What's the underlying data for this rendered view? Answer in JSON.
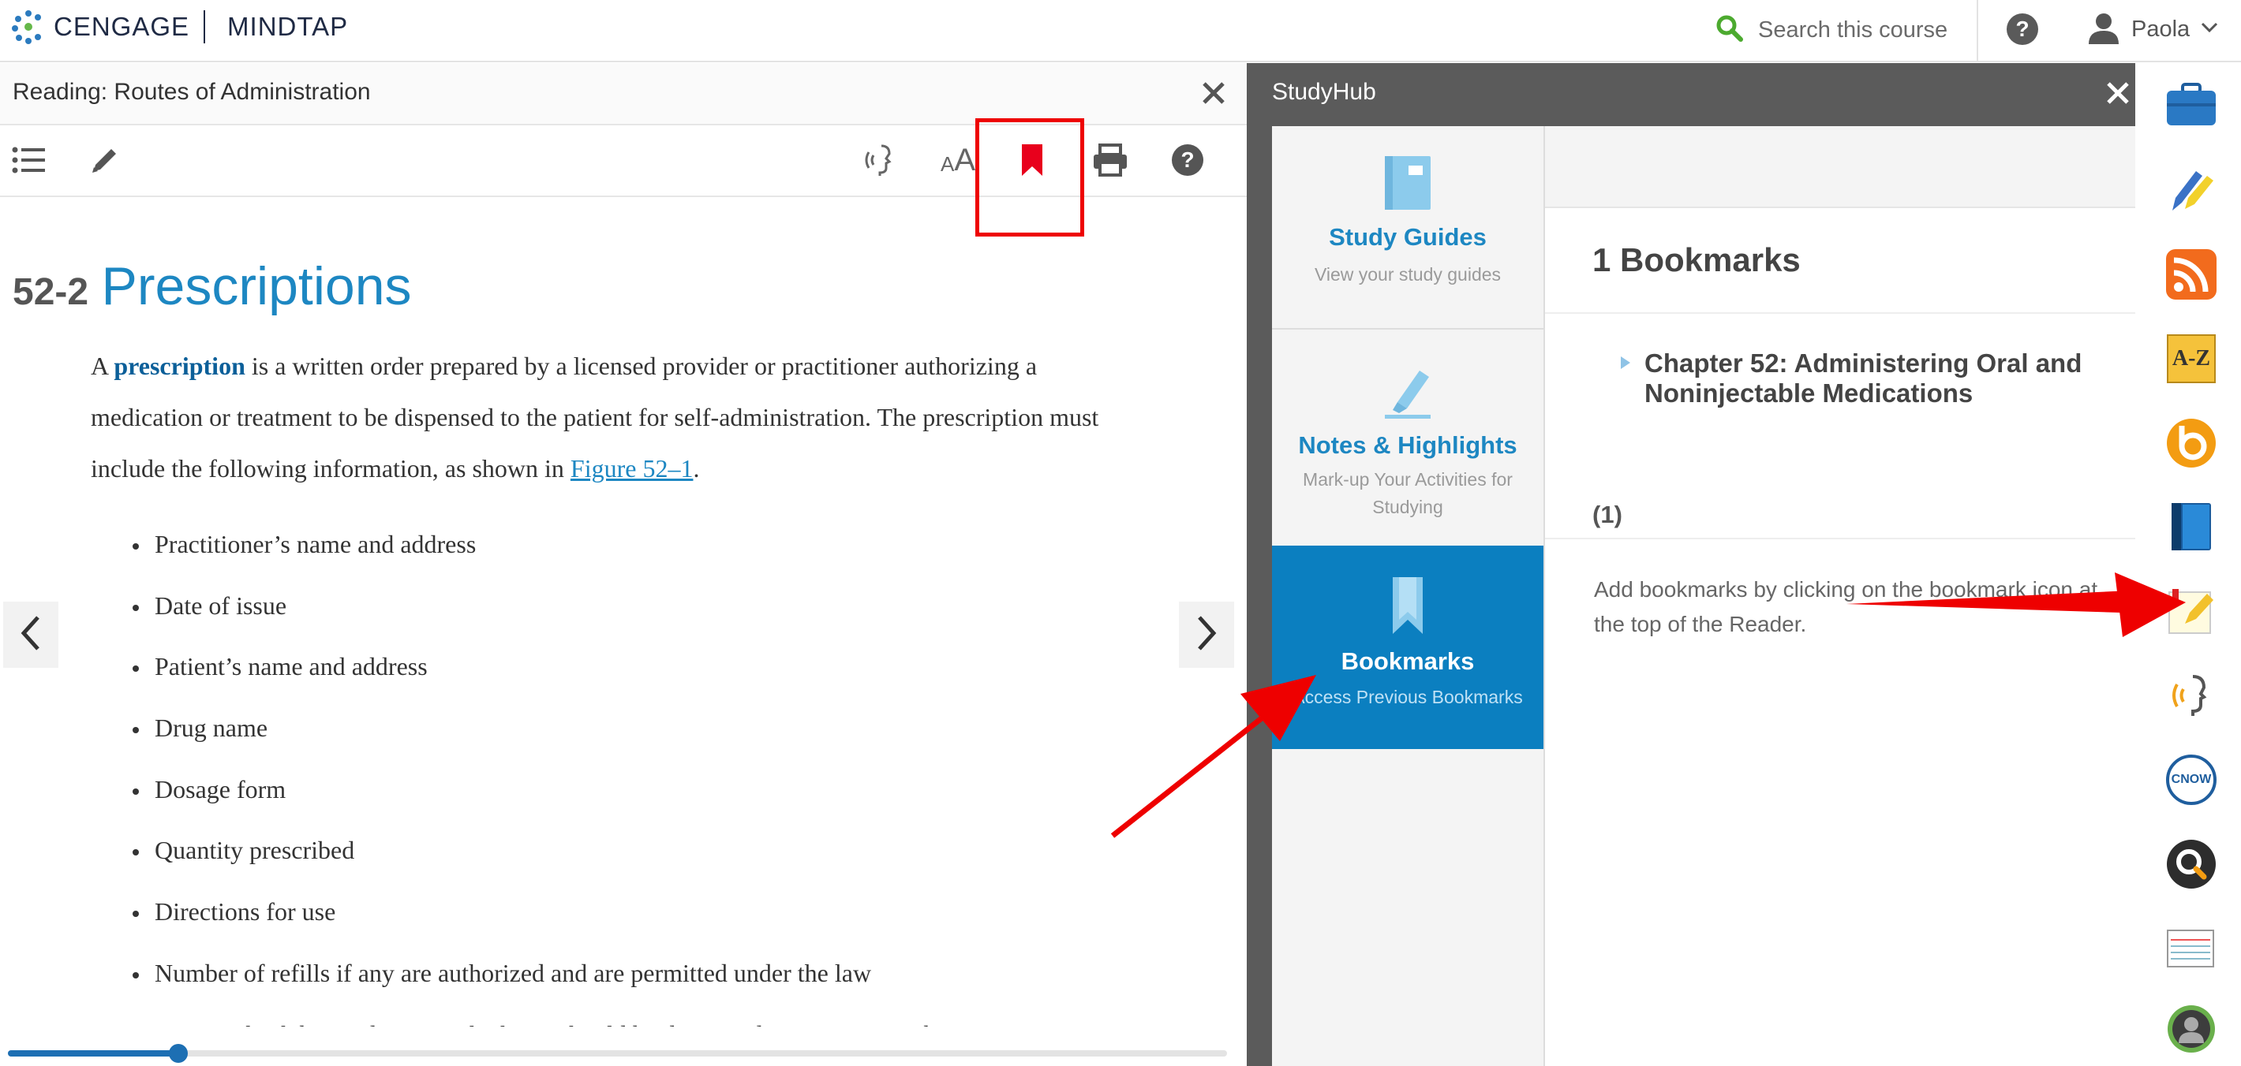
{
  "header": {
    "brand_left": "CENGAGE",
    "brand_right": "MINDTAP",
    "search_label": "Search this course",
    "help_label": "?",
    "user_name": "Paola"
  },
  "reader": {
    "title": "Reading: Routes of Administration",
    "toolbar_icons": [
      "list-icon",
      "pencil-icon",
      "read-aloud-icon",
      "text-size-icon",
      "bookmark-icon",
      "print-icon",
      "help-icon"
    ],
    "text_size_small": "A",
    "text_size_large": "A",
    "section_number": "52-2",
    "section_title": "Prescriptions",
    "para_pre": "A ",
    "para_term": "prescription",
    "para_mid": " is a written order prepared by a licensed provider or practitioner authorizing a medication or treatment to be dispensed to the patient for self-administration. The prescription must include the following information, as shown in ",
    "para_link": "Figure 52–1",
    "para_post": ".",
    "bullets": [
      "Practitioner’s name and address",
      "Date of issue",
      "Patient’s name and address",
      "Drug name",
      "Dosage form",
      "Quantity prescribed",
      "Directions for use",
      "Number of refills if any are authorized and are permitted under the law",
      "Line or check box indicating whether it should be dispensed as written or substitutions"
    ],
    "progress_fraction": 0.14,
    "accent_color": "#1d87c2",
    "bookmark_color": "#e8001c"
  },
  "studyhub": {
    "title": "StudyHub",
    "tabs": [
      {
        "label": "Study Guides",
        "sub": "View your study guides",
        "icon": "study-guide-icon"
      },
      {
        "label": "Notes & Highlights",
        "sub": "Mark-up Your Activities for Studying",
        "icon": "highlighter-icon"
      },
      {
        "label": "Bookmarks",
        "sub": "Access Previous Bookmarks",
        "icon": "bookmark-ribbon-icon"
      }
    ],
    "active_tab": 2,
    "bookmarks_heading": "1 Bookmarks",
    "chapter": "Chapter 52: Administering Oral and Noninjectable Medications",
    "count": "(1)",
    "hint": "Add bookmarks by clicking on the bookmark icon at the top of the Reader.",
    "active_color": "#0b7fc0"
  },
  "rail": {
    "icons": [
      "briefcase-icon",
      "pen-highlighter-icon",
      "rss-icon",
      "glossary-az-icon",
      "play-app-icon",
      "book-icon",
      "studyhub-notepad-icon",
      "read-speaker-icon",
      "cnow-icon",
      "quiz-search-icon",
      "flashcards-icon",
      "avatar-icon"
    ],
    "az_label": "A-Z",
    "cnow_label": "CNOW"
  }
}
